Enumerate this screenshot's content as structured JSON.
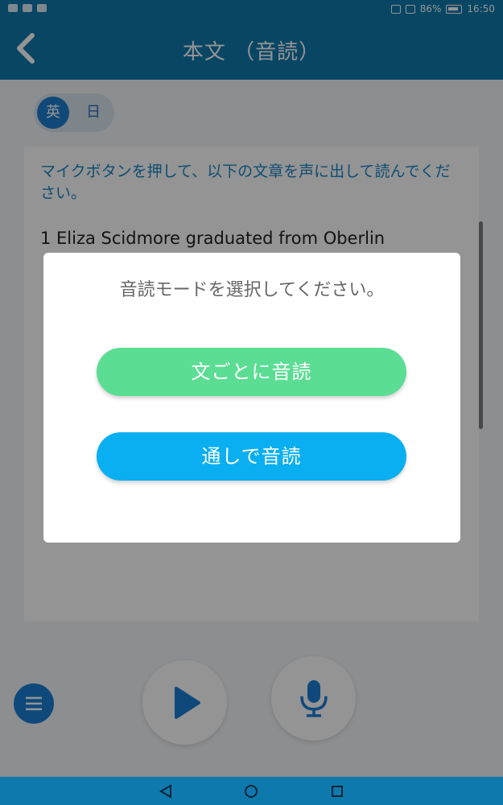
{
  "status_bar": {
    "battery": "86%",
    "time": "16:50"
  },
  "header": {
    "title": "本文 （音読）",
    "back_icon": "chevron-left-icon"
  },
  "lang_toggle": {
    "english_label": "英",
    "japanese_label": "日",
    "selected": "英"
  },
  "content": {
    "instruction": "マイクボタンを押して、以下の文章を声に出して読んでください。",
    "passage_visible_text": "1 Eliza Scidmore graduated from Oberlin"
  },
  "dialog": {
    "title": "音読モードを選択してください。",
    "sentence_button": "文ごとに音読",
    "through_button": "通しで音読"
  },
  "controls": {
    "menu_icon": "playlist-icon",
    "play_icon": "play-icon",
    "mic_icon": "microphone-icon"
  },
  "nav": {
    "back_icon": "nav-back-icon",
    "home_icon": "nav-home-icon",
    "recents_icon": "nav-recents-icon"
  },
  "colors": {
    "header": "#0e79ad",
    "sentence_button": "#5bdd93",
    "through_button": "#0aaff1",
    "instruction_text": "#1a86c4"
  }
}
